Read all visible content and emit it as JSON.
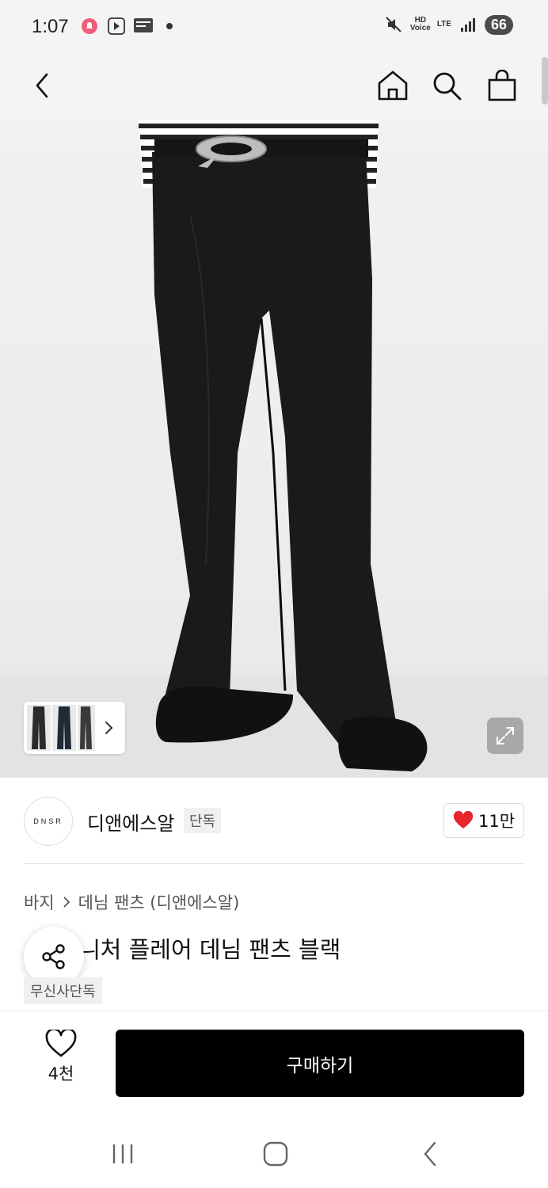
{
  "status_bar": {
    "time": "1:07",
    "left_icons": [
      "notification-bell-icon",
      "media-icon",
      "timesheet-manager-icon"
    ],
    "voice_label": "HD\nVoice",
    "network_label": "LTE",
    "battery": "66"
  },
  "nav": {
    "back_icon": "chevron-left-icon",
    "home_icon": "home-icon",
    "search_icon": "search-icon",
    "cart_icon": "shopping-bag-icon"
  },
  "product": {
    "brand_logo_text": "DNSR",
    "brand_name": "디앤에스알",
    "brand_tag": "단독",
    "brand_likes": "11만",
    "breadcrumb": [
      "바지",
      "데님 팬츠 (디앤에스알)"
    ],
    "title": "ㅢ처 플레어 데님 팬츠 블랙",
    "exclusive_badge": "무신사단독"
  },
  "actions": {
    "wish_count": "4천",
    "buy_label": "구매하기"
  },
  "colors": {
    "accent": "#000000",
    "heart": "#e8242c"
  }
}
